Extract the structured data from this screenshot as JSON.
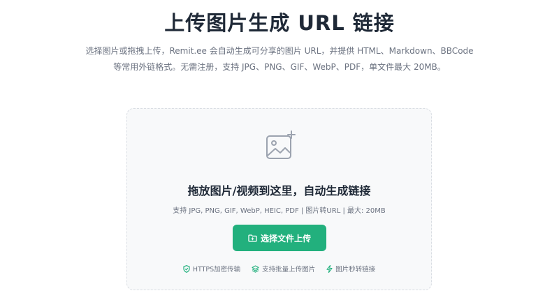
{
  "header": {
    "title": "上传图片生成 URL 链接",
    "description": "选择图片或拖拽上传，Remit.ee 会自动生成可分享的图片 URL，并提供 HTML、Markdown、BBCode 等常用外链格式。无需注册，支持 JPG、PNG、GIF、WebP、PDF，单文件最大 20MB。"
  },
  "dropzone": {
    "icon": "image-add-icon",
    "title": "拖放图片/视频到这里，自动生成链接",
    "formats": "支持 JPG, PNG, GIF, WebP, HEIC, PDF | 图片转URL | 最大: 20MB",
    "button_label": "选择文件上传",
    "button_icon": "folder-icon",
    "accent_color": "#22b07d"
  },
  "features": [
    {
      "icon": "shield-icon",
      "label": "HTTPS加密传输"
    },
    {
      "icon": "layers-icon",
      "label": "支持批量上传图片"
    },
    {
      "icon": "lightning-icon",
      "label": "图片秒转链接"
    }
  ]
}
